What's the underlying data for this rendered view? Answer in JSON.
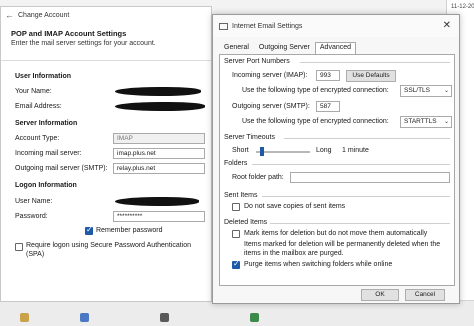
{
  "background": {
    "date": "11-12-2022",
    "right_col_letters": [
      "S",
      "S",
      "F",
      "S",
      "S",
      "S",
      "S",
      "S",
      "S",
      "S",
      "S",
      "S"
    ],
    "status_bar_icons": [
      "folder-icon",
      "calendar-icon",
      "people-icon",
      "tasks-icon"
    ]
  },
  "change_account": {
    "title": "Change Account",
    "header_title": "POP and IMAP Account Settings",
    "header_subtitle": "Enter the mail server settings for your account.",
    "user_info_heading": "User Information",
    "your_name_label": "Your Name:",
    "email_label": "Email Address:",
    "server_info_heading": "Server Information",
    "account_type_label": "Account Type:",
    "account_type_value": "IMAP",
    "incoming_label": "Incoming mail server:",
    "incoming_value": "imap.plus.net",
    "outgoing_label": "Outgoing mail server (SMTP):",
    "outgoing_value": "relay.plus.net",
    "logon_heading": "Logon Information",
    "username_label": "User Name:",
    "password_label": "Password:",
    "password_value": "**********",
    "remember_password_label": "Remember password",
    "remember_password_checked": true,
    "spa_label_line1": "Require logon using Secure Password Authentication",
    "spa_label_line2": "(SPA)",
    "spa_checked": false
  },
  "internet_email": {
    "title": "Internet Email Settings",
    "tabs": [
      "General",
      "Outgoing Server",
      "Advanced"
    ],
    "active_tab": "Advanced",
    "server_ports_heading": "Server Port Numbers",
    "incoming_imap_label": "Incoming server (IMAP):",
    "incoming_imap_value": "993",
    "use_defaults_button": "Use Defaults",
    "encryption_label_1": "Use the following type of encrypted connection:",
    "encryption_value_1": "SSL/TLS",
    "outgoing_smtp_label": "Outgoing server (SMTP):",
    "outgoing_smtp_value": "587",
    "encryption_label_2": "Use the following type of encrypted connection:",
    "encryption_value_2": "STARTTLS",
    "timeouts_heading": "Server Timeouts",
    "timeout_short": "Short",
    "timeout_long": "Long",
    "timeout_value": "1 minute",
    "timeout_level_fraction": 0.12,
    "folders_heading": "Folders",
    "root_folder_label": "Root folder path:",
    "root_folder_value": "",
    "sent_items_heading": "Sent Items",
    "sent_items_label": "Do not save copies of sent items",
    "sent_items_checked": false,
    "deleted_items_heading": "Deleted Items",
    "mark_deletion_label": "Mark items for deletion but do not move them automatically",
    "mark_deletion_checked": false,
    "mark_deletion_note_1": "Items marked for deletion will be permanently deleted when the",
    "mark_deletion_note_2": "items in the mailbox are purged.",
    "purge_label": "Purge items when switching folders while online",
    "purge_checked": true,
    "ok_button": "OK",
    "cancel_button": "Cancel"
  },
  "colors": {
    "accent": "#1e5aa8"
  }
}
